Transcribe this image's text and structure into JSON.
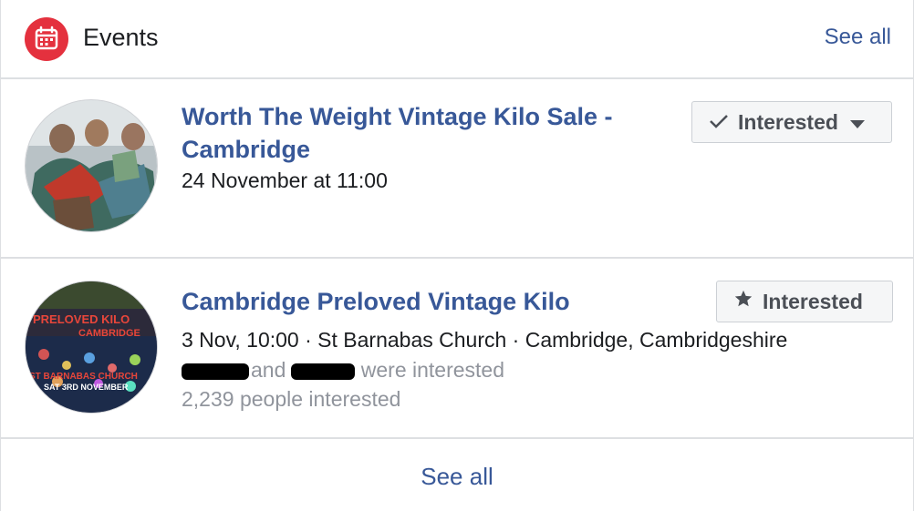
{
  "header": {
    "title": "Events",
    "see_all": "See all",
    "icon": "calendar-icon"
  },
  "events": [
    {
      "title": "Worth The Weight Vintage Kilo Sale - Cambridge",
      "date": "24 November at 11:00",
      "button_label": "Interested",
      "button_icon": "checkmark-icon",
      "has_dropdown": true
    },
    {
      "title": "Cambridge Preloved Vintage Kilo",
      "date": "3 Nov, 10:00 · St Barnabas Church · Cambridge, Cambridgeshire",
      "friends_connector": "and",
      "friends_suffix": "were interested",
      "interested_count": "2,239 people interested",
      "button_label": "Interested",
      "button_icon": "star-icon",
      "thumb_text": {
        "line1": "PRELOVED KILO",
        "line2": "CAMBRIDGE",
        "line3": "ST BARNABAS CHURCH",
        "line4": "SAT 3RD NOVEMBER"
      }
    }
  ],
  "footer": {
    "see_all": "See all"
  },
  "colors": {
    "link": "#385898",
    "accent_red": "#e4313e",
    "muted": "#90949c",
    "divider": "#dddfe2"
  }
}
